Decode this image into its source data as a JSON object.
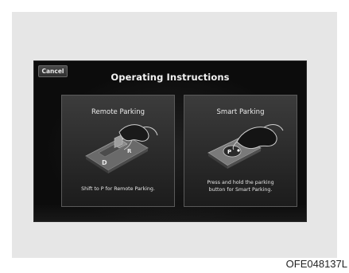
{
  "screen": {
    "title": "Operating Instructions",
    "cancel_label": "Cancel"
  },
  "cards": [
    {
      "title": "Remote Parking",
      "description": "Shift to P for Remote Parking.",
      "illustration": "gear-shifter-icon"
    },
    {
      "title": "Smart Parking",
      "description": "Press and hold the parking\nbutton for Smart Parking.",
      "illustration": "parking-button-icon"
    }
  ],
  "figure_code": "OFE048137L",
  "colors": {
    "screen_background": "#0c0c0c",
    "card_background": "#333333",
    "text": "#f2f2f2",
    "frame": "#e6e6e6"
  }
}
